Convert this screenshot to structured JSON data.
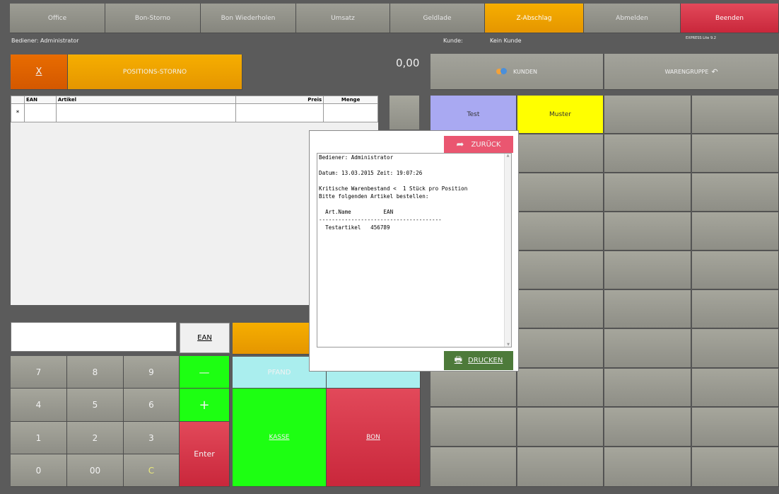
{
  "topbar": {
    "office": "Office",
    "bon_storno": "Bon-Storno",
    "bon_wiederholen": "Bon Wiederholen",
    "umsatz": "Umsatz",
    "geldlade": "Geldlade",
    "z_abschlag": "Z-Abschlag",
    "abmelden": "Abmelden",
    "beenden": "Beenden"
  },
  "info": {
    "bediener": "Bediener: Administrator",
    "kunde_label": "Kunde:",
    "kunde_value": "Kein Kunde",
    "version": "EXPRESS Lite 9.2",
    "total": "0,00"
  },
  "actions": {
    "x_label": "X",
    "positions_storno": "POSITIONS-STORNO",
    "kunden": "KUNDEN",
    "warengruppe": "WARENGRUPPE"
  },
  "table": {
    "headers": [
      "EAN",
      "Artikel",
      "Preis",
      "Menge"
    ],
    "row_marker": "*"
  },
  "input": {
    "ean_button": "EAN",
    "value": ""
  },
  "keypad": {
    "keys": [
      "7",
      "8",
      "9",
      "4",
      "5",
      "6",
      "1",
      "2",
      "3",
      "0",
      "00",
      "C"
    ],
    "minus": "—",
    "plus": "+",
    "enter": "Enter"
  },
  "payment": {
    "pfand": "PFAND",
    "kasse": "KASSE",
    "bon": "BON"
  },
  "categories": [
    "Test",
    "Muster"
  ],
  "popup": {
    "zurueck": "ZURÜCK",
    "drucken": "DRUCKEN",
    "lines": [
      "Bediener: Administrator",
      "",
      "Datum: 13.03.2015 Zeit: 19:07:26",
      "",
      "Kritische Warenbestand <  1 Stück pro Position",
      "Bitte folgenden Artikel bestellen:",
      "",
      "  Art.Name          EAN",
      "--------------------------------------",
      "  Testartikel   456789"
    ]
  },
  "colors": {
    "accent_orange": "#f6ae00",
    "danger_red": "#d2334a",
    "go_green": "#1dff12",
    "category_test": "#a9a9f2",
    "category_muster": "#ffff00",
    "print_green": "#4d7a3a",
    "back_pink": "#ea5670"
  }
}
